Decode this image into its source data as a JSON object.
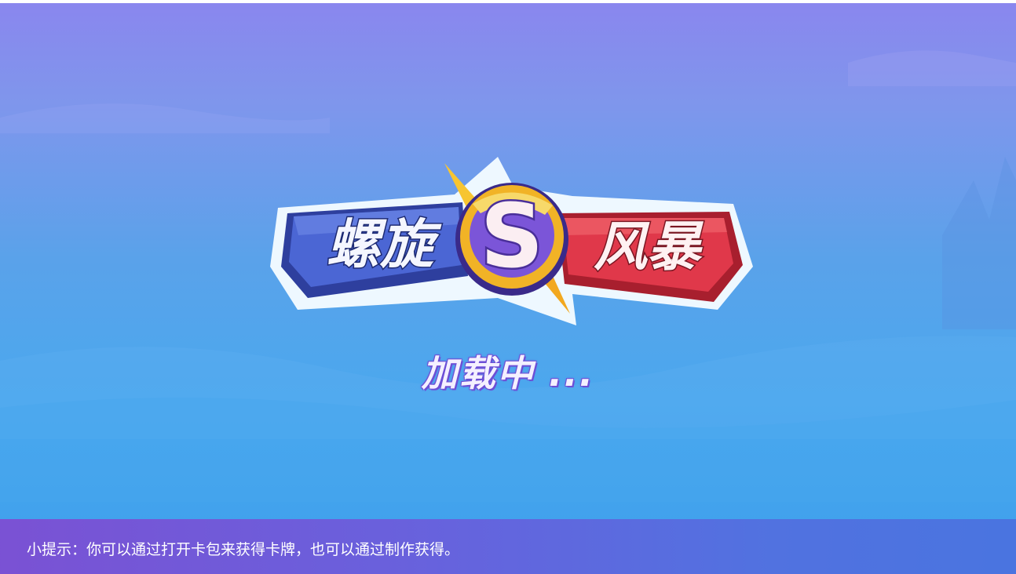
{
  "game": {
    "title_left": "螺旋",
    "title_emblem": "S",
    "title_right": "风暴"
  },
  "loading": {
    "text": "加载中 ..."
  },
  "tip": {
    "label": "小提示",
    "separator": "：",
    "body": "你可以通过打开卡包来获得卡牌，也可以通过制作获得。"
  },
  "colors": {
    "background_top": "#8a86ee",
    "background_bottom": "#3d9fec",
    "logo_blue_plate": "#2f4aa8",
    "logo_red_plate": "#d8313f",
    "emblem_gold": "#f2b52a",
    "emblem_purple": "#7b55d8",
    "tip_bar": "#6a5fdc"
  }
}
